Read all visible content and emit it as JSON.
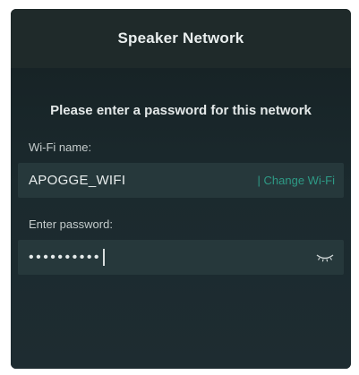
{
  "header": {
    "title": "Speaker Network"
  },
  "prompt": "Please enter a password for this network",
  "wifi": {
    "label": "Wi-Fi name:",
    "ssid": "APOGGE_WIFI",
    "change_label": "| Change Wi-Fi"
  },
  "password": {
    "label": "Enter password:",
    "masked_value": "••••••••••",
    "visibility_icon": "eye-closed-icon"
  },
  "colors": {
    "panel_bg": "#1b2326",
    "field_bg": "#26383b",
    "accent": "#2e9a86"
  }
}
